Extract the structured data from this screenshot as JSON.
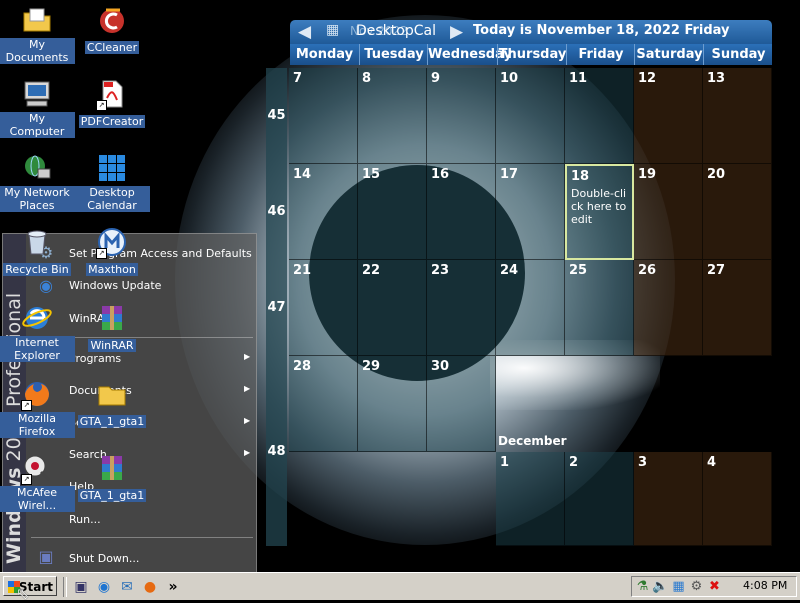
{
  "calendar": {
    "app_name": "DesktopCal",
    "month_label": "Nov 2022",
    "today_text": "Today is November 18, 2022 Friday",
    "weekdays": [
      "Monday",
      "Tuesday",
      "Wednesday",
      "Thursday",
      "Friday",
      "Saturday",
      "Sunday"
    ],
    "weeks": [
      "45",
      "46",
      "47",
      "48"
    ],
    "days": [
      "7",
      "8",
      "9",
      "10",
      "11",
      "12",
      "13",
      "14",
      "15",
      "16",
      "17",
      "18",
      "19",
      "20",
      "21",
      "22",
      "23",
      "24",
      "25",
      "26",
      "27",
      "28",
      "29",
      "30"
    ],
    "today_hint": "Double-click here to edit",
    "next_month_label": "December",
    "next_month_days": [
      "1",
      "2",
      "3",
      "4"
    ]
  },
  "start_menu": {
    "banner": {
      "bold": "Windows",
      "rest": "2000 Professional"
    },
    "items": {
      "set_program_access": "Set Program Access and Defaults",
      "windows_update": "Windows Update",
      "winrar": "WinRAR",
      "programs": "Programs",
      "documents": "Documents",
      "settings": "Settings",
      "search": "Search",
      "help": "Help",
      "run": "Run...",
      "shut_down": "Shut Down..."
    }
  },
  "desktop_icons": {
    "my_documents": "My Documents",
    "ccleaner": "CCleaner",
    "my_computer": "My Computer",
    "pdfcreator": "PDFCreator",
    "my_network_places": "My Network Places",
    "desktop_calendar": "Desktop Calendar",
    "recycle_bin": "Recycle Bin",
    "maxthon": "Maxthon",
    "internet_explorer": "Internet Explorer",
    "winrar": "WinRAR",
    "mozilla_firefox": "Mozilla Firefox",
    "gta_folder": "GTA_1_gta1",
    "mcafee": "McAfee Wirel...",
    "gta_archive": "GTA_1_gta1"
  },
  "taskbar": {
    "start_label": "Start",
    "quicklaunch_more": "»",
    "clock": "4:08 PM"
  },
  "colors": {
    "header": "#2b6fb0",
    "icon_label": "#355e9a",
    "taskbar": "#d4d0c8"
  }
}
